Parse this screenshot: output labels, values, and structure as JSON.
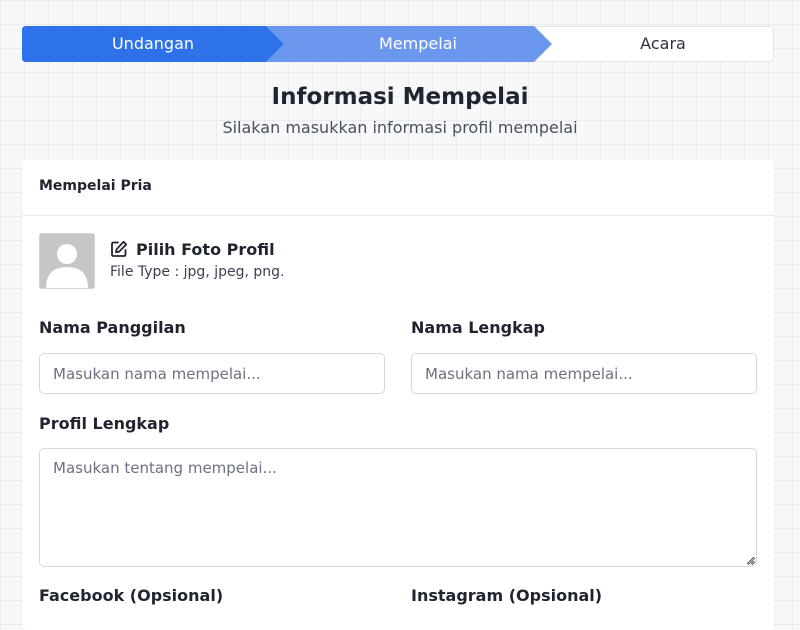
{
  "stepper": {
    "steps": [
      {
        "label": "Undangan",
        "state": "completed",
        "color": "#2e72ea"
      },
      {
        "label": "Mempelai",
        "state": "active",
        "color": "#6c97ee"
      },
      {
        "label": "Acara",
        "state": "pending",
        "color": "#ffffff"
      }
    ]
  },
  "header": {
    "title": "Informasi Mempelai",
    "subtitle": "Silakan masukkan informasi profil mempelai"
  },
  "card": {
    "title": "Mempelai Pria",
    "photo": {
      "button_label": "Pilih Foto Profil",
      "file_type": "File Type : jpg, jpeg, png.",
      "icon": "edit-icon"
    },
    "fields": {
      "nickname": {
        "label": "Nama Panggilan",
        "placeholder": "Masukan nama mempelai..."
      },
      "fullname": {
        "label": "Nama Lengkap",
        "placeholder": "Masukan nama mempelai..."
      },
      "profile": {
        "label": "Profil Lengkap",
        "placeholder": "Masukan tentang mempelai..."
      },
      "facebook": {
        "label": "Facebook (Opsional)"
      },
      "instagram": {
        "label": "Instagram (Opsional)"
      }
    }
  }
}
